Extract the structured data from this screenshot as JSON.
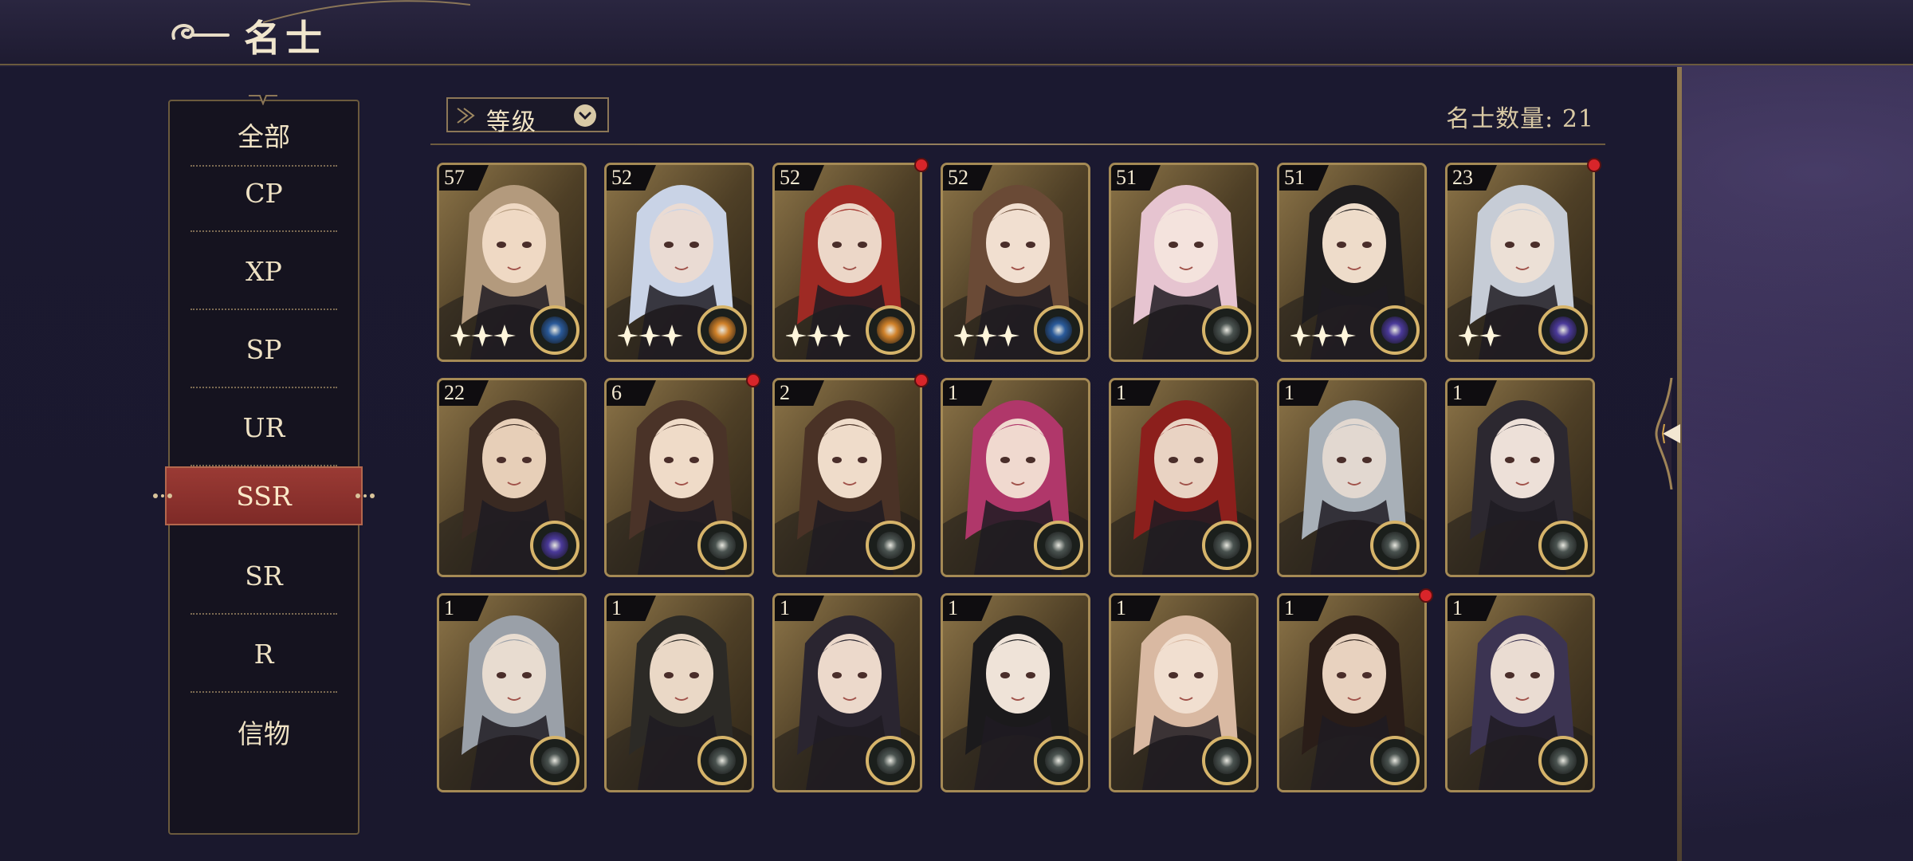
{
  "header": {
    "title": "名士"
  },
  "sidebar": {
    "items": [
      {
        "label": "全部",
        "active": false
      },
      {
        "label": "CP",
        "active": false
      },
      {
        "label": "XP",
        "active": false
      },
      {
        "label": "SP",
        "active": false
      },
      {
        "label": "UR",
        "active": false
      },
      {
        "label": "SSR",
        "active": true
      },
      {
        "label": "SR",
        "active": false
      },
      {
        "label": "R",
        "active": false
      },
      {
        "label": "信物",
        "active": false
      }
    ]
  },
  "sort": {
    "label": "等级"
  },
  "count": {
    "text": "名士数量: 21"
  },
  "colors": {
    "accent_gold": "#a58a55",
    "active_tab": "#8b322e",
    "red_dot": "#d8252a",
    "badge_blue": "#2a5a9a",
    "badge_orange": "#d1822a",
    "badge_purple": "#4b3a9a",
    "badge_gray": "#4a5350"
  },
  "cards": [
    {
      "level": "57",
      "badge": "blue",
      "stars": 3,
      "dot": false,
      "hair": "#b39a7d",
      "skin": "#efd9c4"
    },
    {
      "level": "52",
      "badge": "orange",
      "stars": 3,
      "dot": false,
      "hair": "#c9d3e6",
      "skin": "#eadbd3"
    },
    {
      "level": "52",
      "badge": "orange",
      "stars": 3,
      "dot": true,
      "hair": "#9e2a24",
      "skin": "#ecd7c8"
    },
    {
      "level": "52",
      "badge": "blue",
      "stars": 3,
      "dot": false,
      "hair": "#6a4a36",
      "skin": "#f1dfd0"
    },
    {
      "level": "51",
      "badge": "gray",
      "stars": 0,
      "dot": false,
      "hair": "#e6c4d0",
      "skin": "#f4e3dd"
    },
    {
      "level": "51",
      "badge": "purple",
      "stars": 3,
      "dot": false,
      "hair": "#1e1c1e",
      "skin": "#eedcca"
    },
    {
      "level": "23",
      "badge": "purple",
      "stars": 2,
      "dot": true,
      "hair": "#c6ccd6",
      "skin": "#ece0d6"
    },
    {
      "level": "22",
      "badge": "purple",
      "stars": 0,
      "dot": false,
      "hair": "#3a2a22",
      "skin": "#e7cfb8"
    },
    {
      "level": "6",
      "badge": "gray",
      "stars": 0,
      "dot": true,
      "hair": "#4a3328",
      "skin": "#efdbc8"
    },
    {
      "level": "2",
      "badge": "gray",
      "stars": 0,
      "dot": true,
      "hair": "#4a3226",
      "skin": "#efdcca"
    },
    {
      "level": "1",
      "badge": "gray",
      "stars": 0,
      "dot": false,
      "hair": "#b0376a",
      "skin": "#f0d9cf"
    },
    {
      "level": "1",
      "badge": "gray",
      "stars": 0,
      "dot": false,
      "hair": "#8c1f1c",
      "skin": "#e9d3c3"
    },
    {
      "level": "1",
      "badge": "gray",
      "stars": 0,
      "dot": false,
      "hair": "#a8b0b8",
      "skin": "#e2d8d0"
    },
    {
      "level": "1",
      "badge": "gray",
      "stars": 0,
      "dot": false,
      "hair": "#2c2830",
      "skin": "#ede0d8"
    },
    {
      "level": "1",
      "badge": "gray",
      "stars": 0,
      "dot": false,
      "hair": "#9aa0a8",
      "skin": "#e8dcd0"
    },
    {
      "level": "1",
      "badge": "gray",
      "stars": 0,
      "dot": false,
      "hair": "#2c2a26",
      "skin": "#ead8c6"
    },
    {
      "level": "1",
      "badge": "gray",
      "stars": 0,
      "dot": false,
      "hair": "#2a2530",
      "skin": "#ecd9cb"
    },
    {
      "level": "1",
      "badge": "gray",
      "stars": 0,
      "dot": false,
      "hair": "#1b1a1c",
      "skin": "#efe3d8"
    },
    {
      "level": "1",
      "badge": "gray",
      "stars": 0,
      "dot": false,
      "hair": "#d9b9a2",
      "skin": "#f1dfd0"
    },
    {
      "level": "1",
      "badge": "gray",
      "stars": 0,
      "dot": true,
      "hair": "#2a1d18",
      "skin": "#e8d2bf"
    },
    {
      "level": "1",
      "badge": "gray",
      "stars": 0,
      "dot": false,
      "hair": "#3c3452",
      "skin": "#eadcd2"
    }
  ]
}
